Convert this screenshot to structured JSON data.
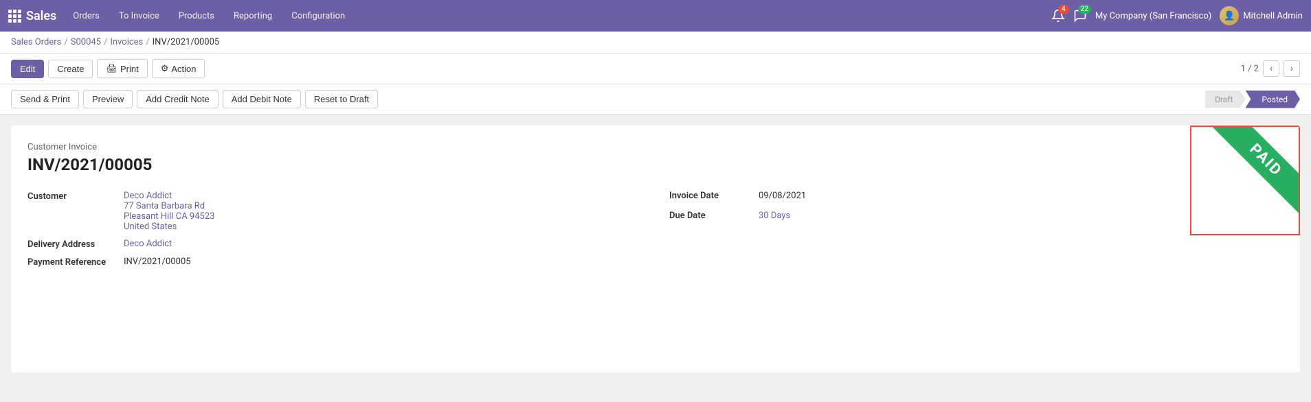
{
  "app": {
    "name": "Sales"
  },
  "topnav": {
    "items": [
      {
        "label": "Orders",
        "id": "orders"
      },
      {
        "label": "To Invoice",
        "id": "to-invoice"
      },
      {
        "label": "Products",
        "id": "products"
      },
      {
        "label": "Reporting",
        "id": "reporting"
      },
      {
        "label": "Configuration",
        "id": "configuration"
      }
    ],
    "notifications_count": "4",
    "messages_count": "22",
    "company": "My Company (San Francisco)",
    "user": "Mitchell Admin"
  },
  "breadcrumb": {
    "parts": [
      {
        "label": "Sales Orders",
        "id": "sales-orders"
      },
      {
        "label": "S00045",
        "id": "s00045"
      },
      {
        "label": "Invoices",
        "id": "invoices"
      },
      {
        "label": "INV/2021/00005",
        "id": "current"
      }
    ]
  },
  "toolbar": {
    "edit_label": "Edit",
    "create_label": "Create",
    "print_label": "Print",
    "action_label": "Action",
    "pagination": "1 / 2"
  },
  "action_bar": {
    "send_print_label": "Send & Print",
    "preview_label": "Preview",
    "add_credit_note_label": "Add Credit Note",
    "add_debit_note_label": "Add Debit Note",
    "reset_draft_label": "Reset to Draft"
  },
  "status": {
    "steps": [
      {
        "label": "Draft",
        "id": "draft",
        "active": false
      },
      {
        "label": "Posted",
        "id": "posted",
        "active": true
      }
    ]
  },
  "invoice": {
    "subtitle": "Customer Invoice",
    "number": "INV/2021/00005",
    "paid_stamp": "PAID",
    "customer_label": "Customer",
    "customer_name": "Deco Addict",
    "customer_address_line1": "77 Santa Barbara Rd",
    "customer_address_line2": "Pleasant Hill CA 94523",
    "customer_address_country": "United States",
    "delivery_address_label": "Delivery Address",
    "delivery_address_value": "Deco Addict",
    "payment_reference_label": "Payment Reference",
    "payment_reference_value": "INV/2021/00005",
    "invoice_date_label": "Invoice Date",
    "invoice_date_value": "09/08/2021",
    "due_date_label": "Due Date",
    "due_date_value": "30 Days"
  }
}
